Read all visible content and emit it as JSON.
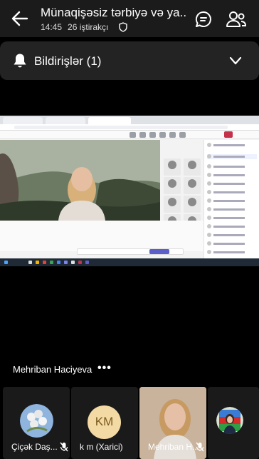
{
  "header": {
    "title": "Münaqişəsiz tərbiyə və ya...",
    "time": "14:45",
    "participants": "26 iştirakçı"
  },
  "notifications": {
    "label": "Bildirişlər (1)"
  },
  "speaker": {
    "name": "Mehriban Haciyeva",
    "more": "•••"
  },
  "thumbnails": [
    {
      "name": "Çiçək Daş...",
      "muted": true
    },
    {
      "name": "k m (Xarici)",
      "initials": "KM",
      "muted": true
    },
    {
      "name": "Mehriban H...",
      "muted": true
    },
    {
      "name": "",
      "muted": false
    }
  ],
  "colors": {
    "accent": "#5b5fc7",
    "initials_bg": "#f3d9a4",
    "header_bg": "#1b1b1b"
  }
}
